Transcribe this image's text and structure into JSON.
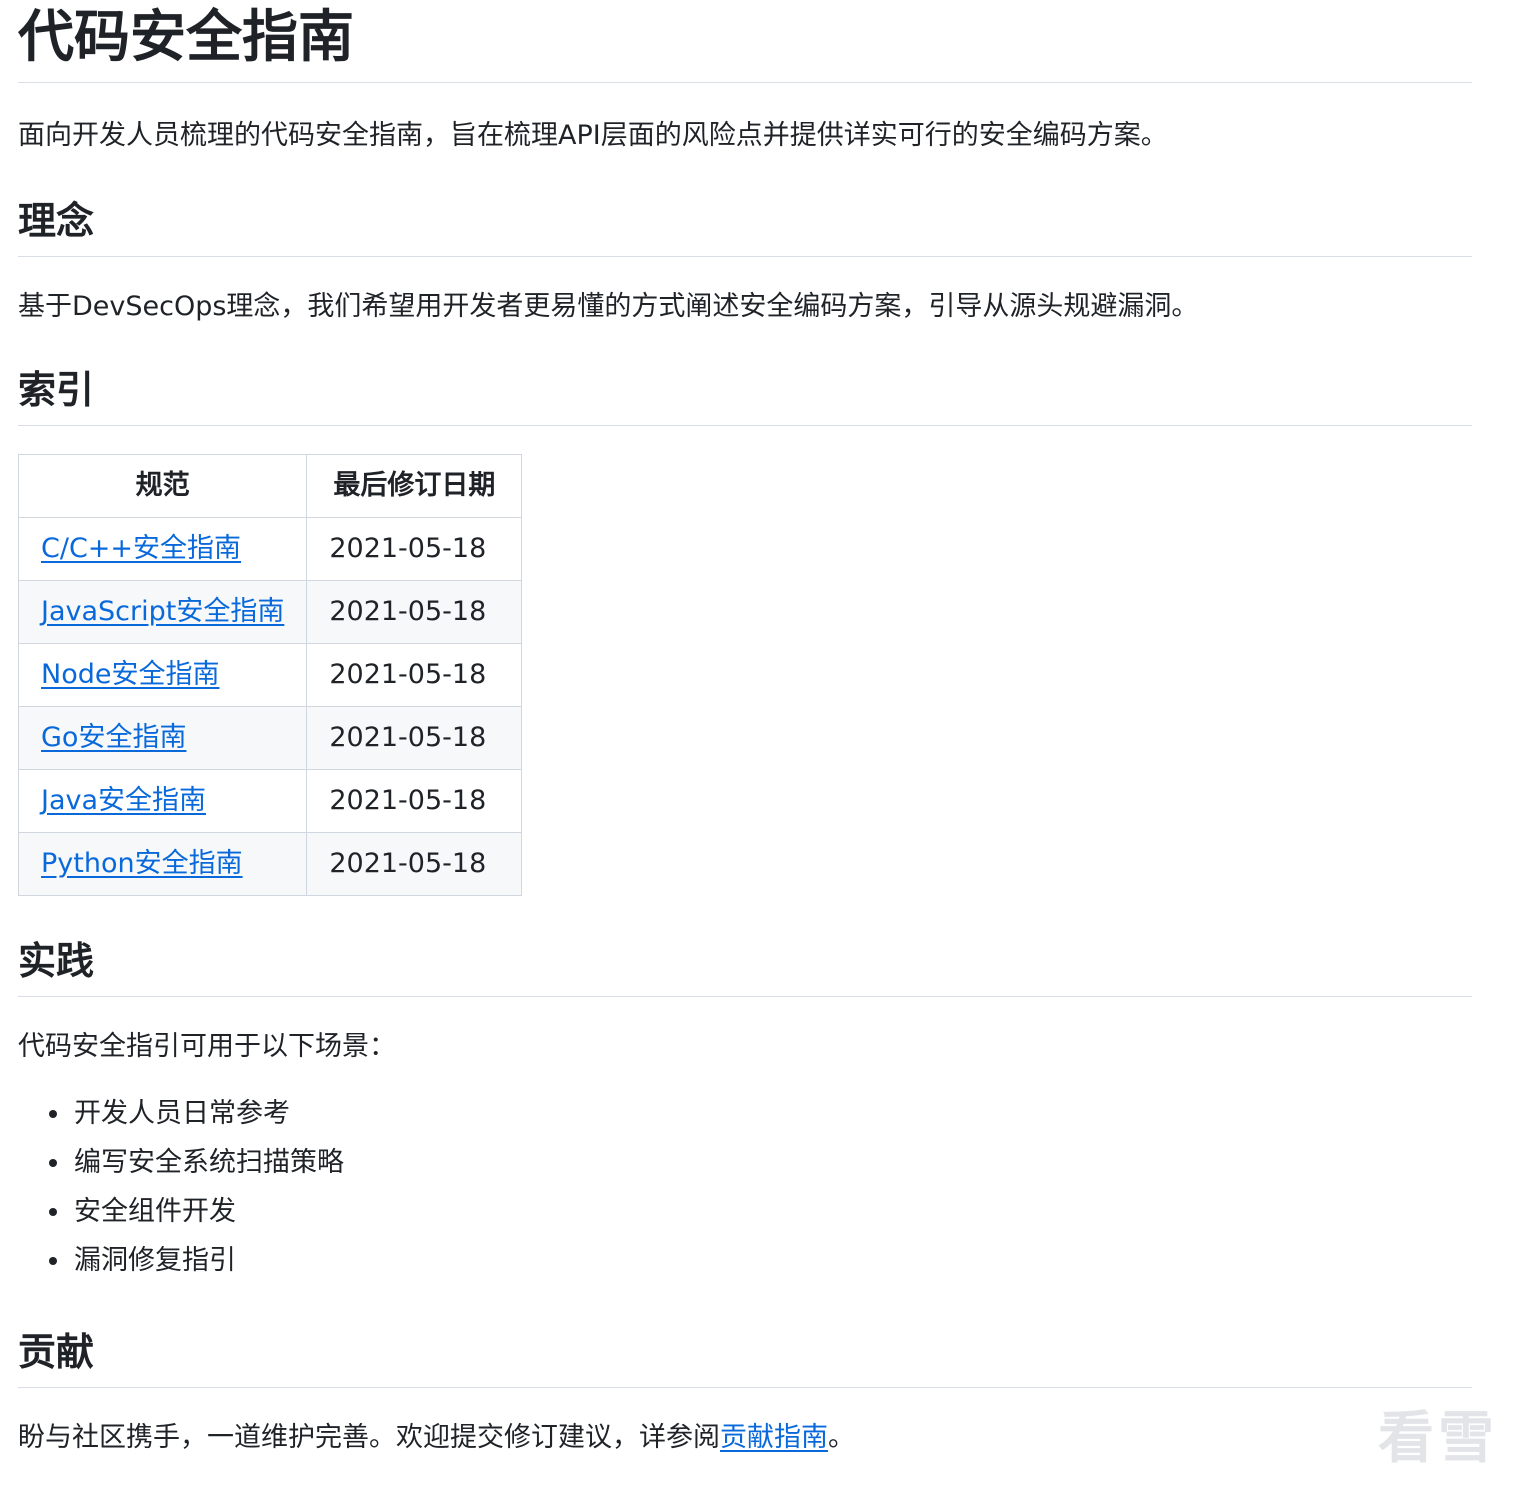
{
  "title": "代码安全指南",
  "intro": "面向开发人员梳理的代码安全指南，旨在梳理API层面的风险点并提供详实可行的安全编码方案。",
  "concept": {
    "heading": "理念",
    "text": "基于DevSecOps理念，我们希望用开发者更易懂的方式阐述安全编码方案，引导从源头规避漏洞。"
  },
  "index": {
    "heading": "索引",
    "columns": [
      "规范",
      "最后修订日期"
    ],
    "rows": [
      {
        "name": "C/C++安全指南",
        "date": "2021-05-18"
      },
      {
        "name": "JavaScript安全指南",
        "date": "2021-05-18"
      },
      {
        "name": "Node安全指南",
        "date": "2021-05-18"
      },
      {
        "name": "Go安全指南",
        "date": "2021-05-18"
      },
      {
        "name": "Java安全指南",
        "date": "2021-05-18"
      },
      {
        "name": "Python安全指南",
        "date": "2021-05-18"
      }
    ]
  },
  "practice": {
    "heading": "实践",
    "text": "代码安全指引可用于以下场景：",
    "items": [
      "开发人员日常参考",
      "编写安全系统扫描策略",
      "安全组件开发",
      "漏洞修复指引"
    ]
  },
  "contribute": {
    "heading": "贡献",
    "text_before": "盼与社区携手，一道维护完善。欢迎提交修订建议，详参阅",
    "link": "贡献指南",
    "text_after": "。"
  },
  "watermark": "看雪"
}
